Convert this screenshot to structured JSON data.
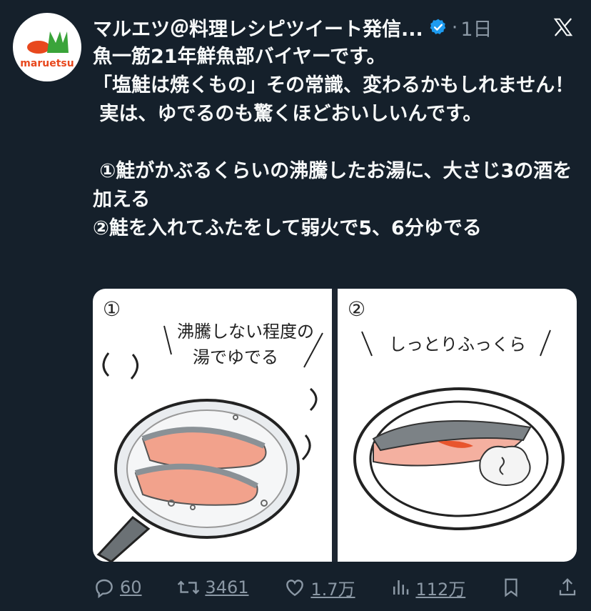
{
  "profile": {
    "brand_text": "maruetsu",
    "display_name": "マルエツ＠料理レシピツイート発信...",
    "time": "1日",
    "dot": "·"
  },
  "tweet": {
    "text": "魚一筋21年鮮魚部バイヤーです。\n「塩鮭は焼くもの」その常識、変わるかもしれません！\n 実は、ゆでるのも驚くほどおいしいんです。\n\n ①鮭がかぶるくらいの沸騰したお湯に、大さじ3の酒を加える\n②鮭を入れてふたをして弱火で5、6分ゆでる"
  },
  "media": {
    "panel1_num": "①",
    "panel1_caption_1": "沸騰しない程度の",
    "panel1_caption_2": "湯でゆでる",
    "panel2_num": "②",
    "panel2_caption": "しっとりふっくら"
  },
  "actions": {
    "replies": "60",
    "reposts": "3461",
    "likes": "1.7万",
    "views": "112万"
  },
  "colors": {
    "background": "#15202b",
    "text": "#f7f9f9",
    "muted": "#8b98a5",
    "verified": "#1d9bf0",
    "brand_red": "#e8481d",
    "brand_green": "#3aa43a"
  }
}
